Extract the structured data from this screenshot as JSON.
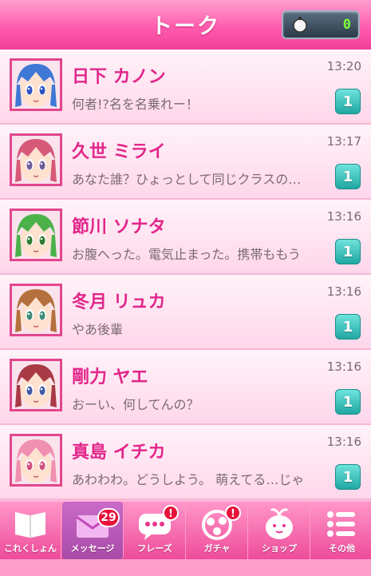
{
  "header": {
    "title": "トーク",
    "counter_value": "0",
    "counter_icon": "bomb-icon"
  },
  "contacts": [
    {
      "name": "日下 カノン",
      "message": "何者!?名を名乗れー！",
      "time": "13:20",
      "unread": "1",
      "hair": "#3f78d6",
      "eyes": "#2d53c4"
    },
    {
      "name": "久世 ミライ",
      "message": "あなた誰？ひょっとして同じクラスの…",
      "time": "13:17",
      "unread": "1",
      "hair": "#d65a78",
      "eyes": "#6f5a9a"
    },
    {
      "name": "節川 ソナタ",
      "message": "お腹へった。電気止まった。携帯ももう",
      "time": "13:16",
      "unread": "1",
      "hair": "#4bb24a",
      "eyes": "#2f7a30"
    },
    {
      "name": "冬月 リュカ",
      "message": "やあ後輩",
      "time": "13:16",
      "unread": "1",
      "hair": "#b4713d",
      "eyes": "#3f8a7a"
    },
    {
      "name": "剛力 ヤエ",
      "message": "おーい、何してんの？",
      "time": "13:16",
      "unread": "1",
      "hair": "#a83a45",
      "eyes": "#3f5aa8"
    },
    {
      "name": "真島 イチカ",
      "message": "あわわわ。どうしよう。 萌えてる…じゃ",
      "time": "13:16",
      "unread": "1",
      "hair": "#f090b0",
      "eyes": "#d2507a"
    }
  ],
  "tabs": [
    {
      "label": "これくしょん",
      "icon": "book-icon"
    },
    {
      "label": "メッセージ",
      "icon": "envelope-icon",
      "count": "29"
    },
    {
      "label": "フレーズ",
      "icon": "speech-bubble-icon",
      "notify": "!"
    },
    {
      "label": "ガチャ",
      "icon": "gacha-capsule-icon",
      "notify": "!"
    },
    {
      "label": "ショップ",
      "icon": "shop-mascot-icon"
    },
    {
      "label": "その他",
      "icon": "menu-list-icon"
    }
  ],
  "colors": {
    "accent": "#e2268a",
    "header_pink": "#ff5cae",
    "badge_teal": "#20a7a2",
    "alert_red": "#e8123a"
  }
}
